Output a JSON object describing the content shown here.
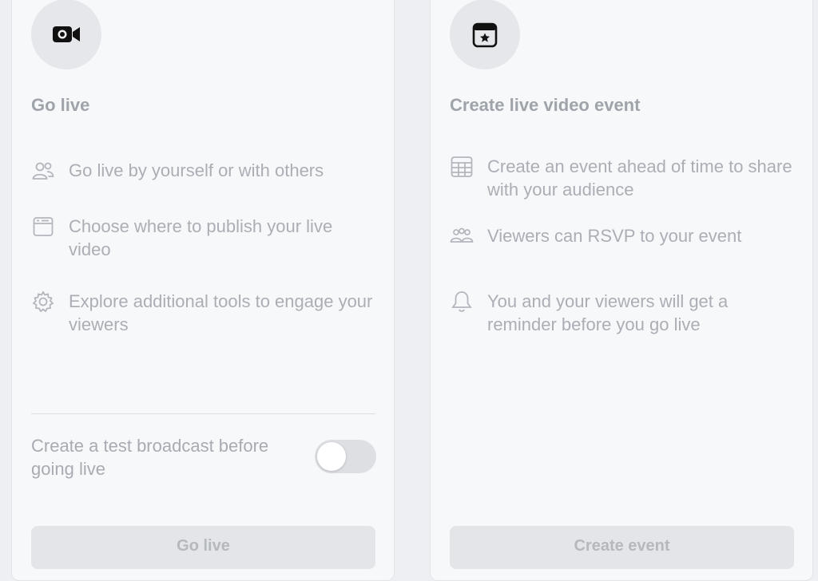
{
  "go_live_card": {
    "icon": "video-camera-icon",
    "title": "Go live",
    "features": [
      {
        "icon": "people-icon",
        "text": "Go live by yourself or with others"
      },
      {
        "icon": "publish-window-icon",
        "text": "Choose where to publish your live video"
      },
      {
        "icon": "gear-icon",
        "text": "Explore additional tools to engage your viewers"
      }
    ],
    "toggle": {
      "label": "Create a test broadcast before going live",
      "on": false
    },
    "button_label": "Go live"
  },
  "event_card": {
    "icon": "calendar-star-icon",
    "title": "Create live video event",
    "features": [
      {
        "icon": "calendar-grid-icon",
        "text": "Create an event ahead of time to share with your audience"
      },
      {
        "icon": "group-icon",
        "text": "Viewers can RSVP to your event"
      },
      {
        "icon": "bell-icon",
        "text": "You and your viewers will get a reminder before you go live"
      }
    ],
    "button_label": "Create event"
  },
  "colors": {
    "page_bg": "#eeeff2",
    "card_bg": "#f7f8fa",
    "icon_circle": "#e6e7eb",
    "muted_text": "#a8abb1",
    "button_bg": "#e4e5e8"
  }
}
